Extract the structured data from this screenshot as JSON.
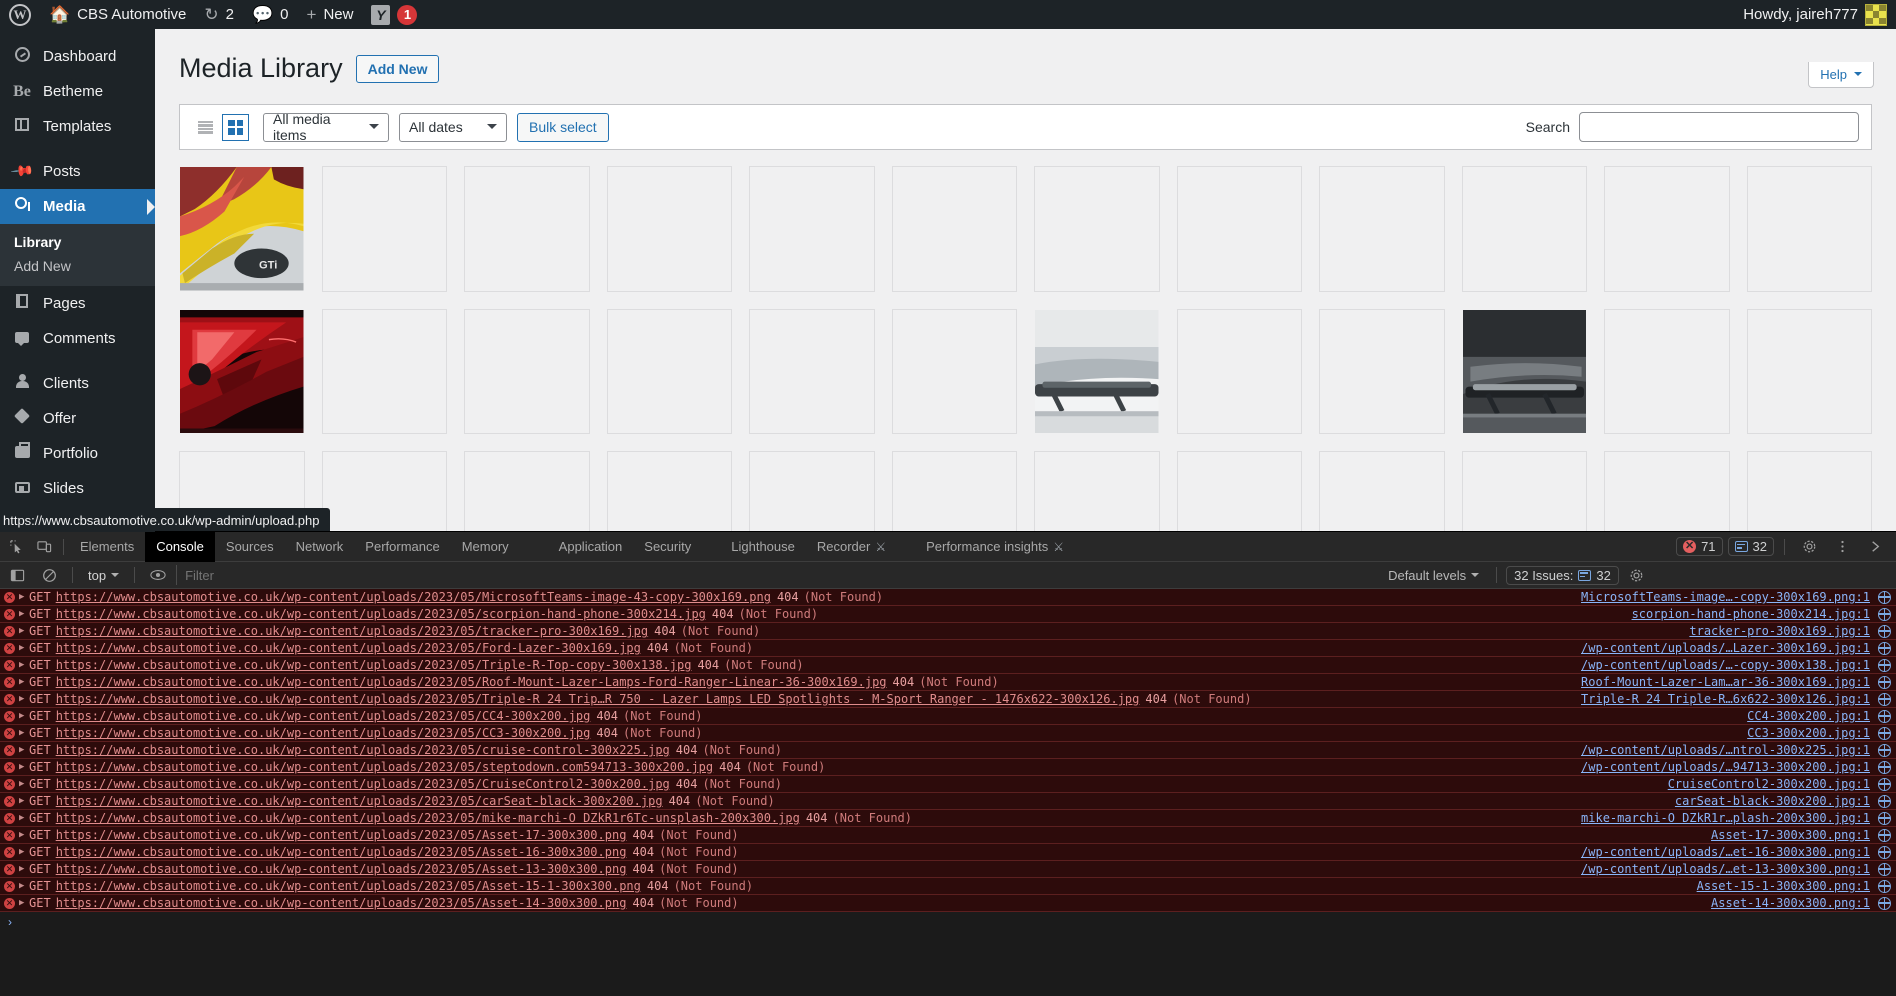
{
  "adminbar": {
    "wp_logo": "wordpress-logo-icon",
    "site_name": "CBS Automotive",
    "updates_count": "2",
    "comments_count": "0",
    "new_label": "New",
    "yoast_label": "Y",
    "yoast_badge": "1",
    "howdy": "Howdy, jaireh777"
  },
  "sidebar": {
    "items": [
      {
        "label": "Dashboard",
        "icon": "dashboard-icon"
      },
      {
        "label": "Betheme",
        "icon": "betheme-icon"
      },
      {
        "label": "Templates",
        "icon": "templates-icon"
      },
      {
        "label": "Posts",
        "icon": "posts-pin-icon"
      },
      {
        "label": "Media",
        "icon": "media-icon",
        "active": true
      },
      {
        "label": "Pages",
        "icon": "pages-icon"
      },
      {
        "label": "Comments",
        "icon": "comments-icon"
      },
      {
        "label": "Clients",
        "icon": "clients-user-icon"
      },
      {
        "label": "Offer",
        "icon": "offer-tag-icon"
      },
      {
        "label": "Portfolio",
        "icon": "portfolio-case-icon"
      },
      {
        "label": "Slides",
        "icon": "slides-icon"
      }
    ],
    "submenu": [
      {
        "label": "Library",
        "current": true
      },
      {
        "label": "Add New",
        "current": false
      }
    ]
  },
  "statusbar": {
    "url": "https://www.cbsautomotive.co.uk/wp-admin/upload.php"
  },
  "page": {
    "help_label": "Help",
    "title": "Media Library",
    "add_new": "Add New",
    "view_list_icon": "list-view-icon",
    "view_grid_icon": "grid-view-icon",
    "filter_media": "All media items",
    "filter_dates": "All dates",
    "bulk_select": "Bulk select",
    "search_label": "Search",
    "search_value": "",
    "search_placeholder": ""
  },
  "devtools": {
    "inspect_icon": "inspect-element-icon",
    "device_icon": "device-toolbar-icon",
    "tabs": [
      {
        "label": "Elements",
        "active": false
      },
      {
        "label": "Console",
        "active": true
      },
      {
        "label": "Sources",
        "active": false
      },
      {
        "label": "Network",
        "active": false
      },
      {
        "label": "Performance",
        "active": false
      },
      {
        "label": "Memory",
        "active": false
      },
      {
        "label": "Application",
        "active": false
      },
      {
        "label": "Security",
        "active": false
      },
      {
        "label": "Lighthouse",
        "active": false
      },
      {
        "label": "Recorder",
        "active": false,
        "flask": true
      },
      {
        "label": "Performance insights",
        "active": false,
        "flask": true
      }
    ],
    "error_count": "71",
    "message_count": "32",
    "settings_icon": "gear-icon",
    "more_icon": "more-options-icon",
    "close_icon": "close-devtools-icon",
    "sidebar_toggle_icon": "console-sidebar-icon",
    "clear_icon": "clear-console-icon",
    "context": "top",
    "eye_icon": "live-expression-icon",
    "filter_placeholder": "Filter",
    "filter_value": "",
    "levels_label": "Default levels",
    "issues_label": "32 Issues:",
    "issues_count": "32",
    "prompt": "›",
    "logs": [
      {
        "method": "GET",
        "url": "https://www.cbsautomotive.co.uk/wp-content/uploads/2023/05/MicrosoftTeams-image-43-copy-300x169.png",
        "status": "404",
        "text": "(Not Found)",
        "source": "MicrosoftTeams-image…-copy-300x169.png:1"
      },
      {
        "method": "GET",
        "url": "https://www.cbsautomotive.co.uk/wp-content/uploads/2023/05/scorpion-hand-phone-300x214.jpg",
        "status": "404",
        "text": "(Not Found)",
        "source": "scorpion-hand-phone-300x214.jpg:1"
      },
      {
        "method": "GET",
        "url": "https://www.cbsautomotive.co.uk/wp-content/uploads/2023/05/tracker-pro-300x169.jpg",
        "status": "404",
        "text": "(Not Found)",
        "source": "tracker-pro-300x169.jpg:1"
      },
      {
        "method": "GET",
        "url": "https://www.cbsautomotive.co.uk/wp-content/uploads/2023/05/Ford-Lazer-300x169.jpg",
        "status": "404",
        "text": "(Not Found)",
        "source": "/wp-content/uploads/…Lazer-300x169.jpg:1"
      },
      {
        "method": "GET",
        "url": "https://www.cbsautomotive.co.uk/wp-content/uploads/2023/05/Triple-R-Top-copy-300x138.jpg",
        "status": "404",
        "text": "(Not Found)",
        "source": "/wp-content/uploads/…-copy-300x138.jpg:1"
      },
      {
        "method": "GET",
        "url": "https://www.cbsautomotive.co.uk/wp-content/uploads/2023/05/Roof-Mount-Lazer-Lamps-Ford-Ranger-Linear-36-300x169.jpg",
        "status": "404",
        "text": "(Not Found)",
        "source": "Roof-Mount-Lazer-Lam…ar-36-300x169.jpg:1"
      },
      {
        "method": "GET",
        "url": "https://www.cbsautomotive.co.uk/wp-content/uploads/2023/05/Triple-R 24 Trip…R 750 - Lazer Lamps LED Spotlights - M-Sport Ranger - 1476x622-300x126.jpg",
        "status": "404",
        "text": "(Not Found)",
        "source": "Triple-R 24 Triple-R…6x622-300x126.jpg:1"
      },
      {
        "method": "GET",
        "url": "https://www.cbsautomotive.co.uk/wp-content/uploads/2023/05/CC4-300x200.jpg",
        "status": "404",
        "text": "(Not Found)",
        "source": "CC4-300x200.jpg:1"
      },
      {
        "method": "GET",
        "url": "https://www.cbsautomotive.co.uk/wp-content/uploads/2023/05/CC3-300x200.jpg",
        "status": "404",
        "text": "(Not Found)",
        "source": "CC3-300x200.jpg:1"
      },
      {
        "method": "GET",
        "url": "https://www.cbsautomotive.co.uk/wp-content/uploads/2023/05/cruise-control-300x225.jpg",
        "status": "404",
        "text": "(Not Found)",
        "source": "/wp-content/uploads/…ntrol-300x225.jpg:1"
      },
      {
        "method": "GET",
        "url": "https://www.cbsautomotive.co.uk/wp-content/uploads/2023/05/steptodown.com594713-300x200.jpg",
        "status": "404",
        "text": "(Not Found)",
        "source": "/wp-content/uploads/…94713-300x200.jpg:1"
      },
      {
        "method": "GET",
        "url": "https://www.cbsautomotive.co.uk/wp-content/uploads/2023/05/CruiseControl2-300x200.jpg",
        "status": "404",
        "text": "(Not Found)",
        "source": "CruiseControl2-300x200.jpg:1"
      },
      {
        "method": "GET",
        "url": "https://www.cbsautomotive.co.uk/wp-content/uploads/2023/05/carSeat-black-300x200.jpg",
        "status": "404",
        "text": "(Not Found)",
        "source": "carSeat-black-300x200.jpg:1"
      },
      {
        "method": "GET",
        "url": "https://www.cbsautomotive.co.uk/wp-content/uploads/2023/05/mike-marchi-O DZkR1r6Tc-unsplash-200x300.jpg",
        "status": "404",
        "text": "(Not Found)",
        "source": "mike-marchi-O DZkR1r…plash-200x300.jpg:1"
      },
      {
        "method": "GET",
        "url": "https://www.cbsautomotive.co.uk/wp-content/uploads/2023/05/Asset-17-300x300.png",
        "status": "404",
        "text": "(Not Found)",
        "source": "Asset-17-300x300.png:1"
      },
      {
        "method": "GET",
        "url": "https://www.cbsautomotive.co.uk/wp-content/uploads/2023/05/Asset-16-300x300.png",
        "status": "404",
        "text": "(Not Found)",
        "source": "/wp-content/uploads/…et-16-300x300.png:1"
      },
      {
        "method": "GET",
        "url": "https://www.cbsautomotive.co.uk/wp-content/uploads/2023/05/Asset-13-300x300.png",
        "status": "404",
        "text": "(Not Found)",
        "source": "/wp-content/uploads/…et-13-300x300.png:1"
      },
      {
        "method": "GET",
        "url": "https://www.cbsautomotive.co.uk/wp-content/uploads/2023/05/Asset-15-1-300x300.png",
        "status": "404",
        "text": "(Not Found)",
        "source": "Asset-15-1-300x300.png:1"
      },
      {
        "method": "GET",
        "url": "https://www.cbsautomotive.co.uk/wp-content/uploads/2023/05/Asset-14-300x300.png",
        "status": "404",
        "text": "(Not Found)",
        "source": "Asset-14-300x300.png:1"
      }
    ]
  },
  "media_grid": {
    "rows": 3,
    "cols": 12,
    "tiles": [
      {
        "index": 0,
        "loaded": true,
        "kind": "yellow-car-rear"
      },
      {
        "index": 12,
        "loaded": true,
        "kind": "red-car-rear"
      },
      {
        "index": 19,
        "loaded": true,
        "kind": "silver-truck-sidestep"
      },
      {
        "index": 21,
        "loaded": true,
        "kind": "dark-truck-sidestep"
      }
    ]
  },
  "colors": {
    "wp_blue": "#2271b1",
    "admin_dark": "#1d2327",
    "admin_submenu": "#2c3338",
    "error_red": "#d63638",
    "console_error_bg": "#2d0b0b",
    "devtools_bg": "#282828"
  }
}
